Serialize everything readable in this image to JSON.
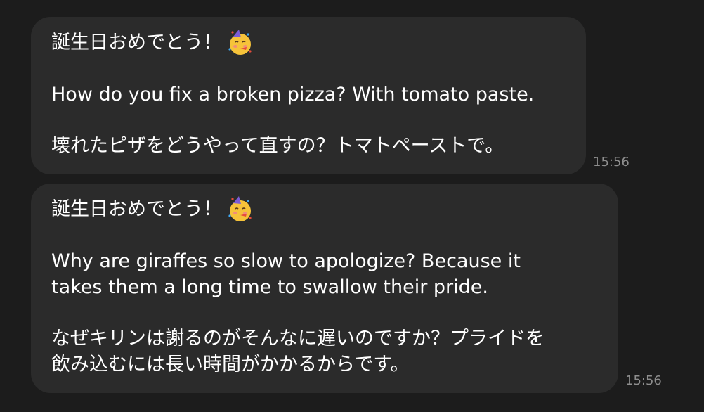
{
  "messages": [
    {
      "greeting": "誕生日おめでとう！",
      "emoji": "partying-face-icon",
      "english": "How do you fix a broken pizza? With tomato paste.",
      "japanese": "壊れたピザをどうやって直すの？トマトペーストで。",
      "time": "15:56"
    },
    {
      "greeting": "誕生日おめでとう！",
      "emoji": "partying-face-icon",
      "english": "Why are giraffes so slow to apologize? Because it\ntakes them a long time to swallow their pride.",
      "japanese": "なぜキリンは謝るのがそんなに遅いのですか？プライドを\n飲み込むには長い時間がかかるからです。",
      "time": "15:56"
    }
  ],
  "colors": {
    "background": "#1c1c1c",
    "bubble": "#2b2b2b",
    "text": "#ffffff",
    "timestamp": "#8e8e8e"
  }
}
